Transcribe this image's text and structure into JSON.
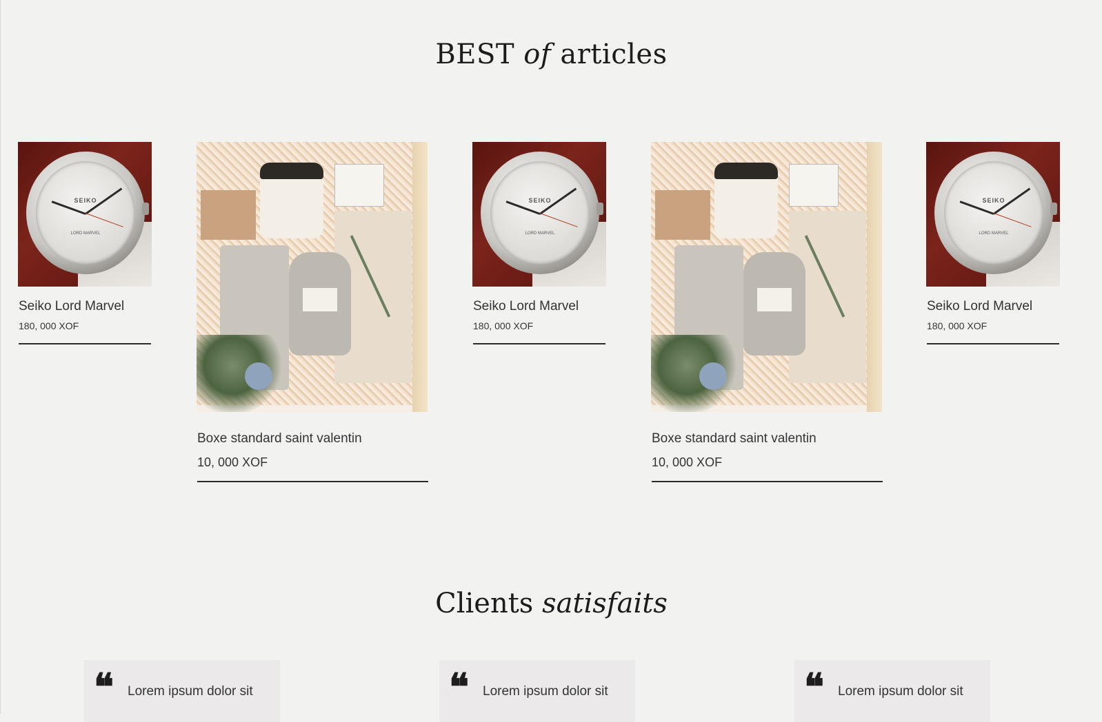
{
  "best_section": {
    "title_part1": "BEST",
    "title_em": "of",
    "title_part2": "articles"
  },
  "products": [
    {
      "name": "Seiko Lord Marvel",
      "price": "180, 000 XOF",
      "image": "watch"
    },
    {
      "name": "Boxe standard saint valentin",
      "price": "10, 000 XOF",
      "image": "gift-box"
    },
    {
      "name": "Seiko Lord Marvel",
      "price": "180, 000 XOF",
      "image": "watch"
    },
    {
      "name": "Boxe standard saint valentin",
      "price": "10, 000 XOF",
      "image": "gift-box"
    },
    {
      "name": "Seiko Lord Marvel",
      "price": "180, 000 XOF",
      "image": "watch"
    }
  ],
  "watch_dial": {
    "brand": "SEIKO",
    "model": "LORD MARVEL"
  },
  "clients_section": {
    "title_part1": "Clients",
    "title_em": "satisfaits"
  },
  "testimonials": [
    {
      "quote_mark": "❝",
      "text": "Lorem ipsum dolor sit"
    },
    {
      "quote_mark": "❝",
      "text": "Lorem ipsum dolor sit"
    },
    {
      "quote_mark": "❝",
      "text": "Lorem ipsum dolor sit"
    }
  ],
  "colors": {
    "background": "#f2f2f1",
    "card": "#ebe9ea",
    "text": "#2a2a2a"
  }
}
